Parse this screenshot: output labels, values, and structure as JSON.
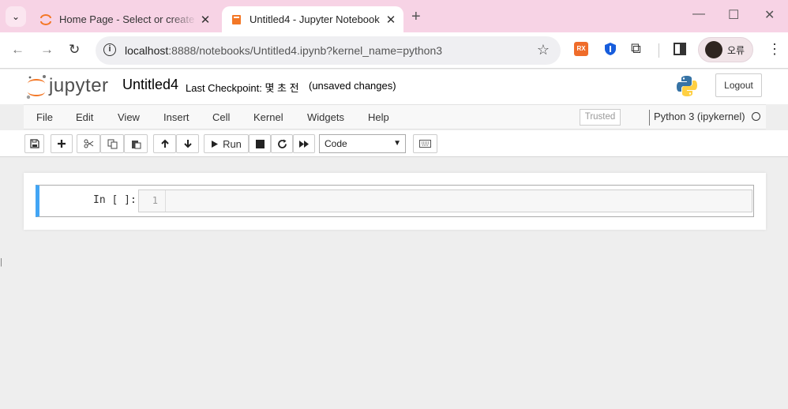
{
  "browser": {
    "tabs": [
      {
        "title": "Home Page - Select or create",
        "close": "✕"
      },
      {
        "title": "Untitled4 - Jupyter Notebook",
        "close": "✕"
      }
    ],
    "new_tab": "+",
    "tab_search_icon": "⌄",
    "window_controls": {
      "minimize": "—",
      "maximize": "☐",
      "close": "✕"
    },
    "nav": {
      "back": "←",
      "forward": "→",
      "reload": "↻"
    },
    "url_host": "localhost",
    "url_rest": ":8888/notebooks/Untitled4.ipynb?kernel_name=python3",
    "bookmark_icon": "☆",
    "extension_rx": "RX",
    "puzzle_icon": "⧉",
    "profile_label": "오류",
    "menu_icon": "⋮",
    "accent": "#f7d3e5"
  },
  "header": {
    "logo_text": "jupyter",
    "notebook_title": "Untitled4",
    "checkpoint_label": "Last Checkpoint:",
    "checkpoint_time": "몇 초 전",
    "unsaved": "(unsaved changes)",
    "logout": "Logout"
  },
  "menubar": {
    "items": [
      "File",
      "Edit",
      "View",
      "Insert",
      "Cell",
      "Kernel",
      "Widgets",
      "Help"
    ],
    "trusted": "Trusted",
    "kernel_name": "Python 3 (ipykernel)"
  },
  "toolbar": {
    "run_label": "Run",
    "cell_type": "Code",
    "cell_type_options": [
      "Code"
    ]
  },
  "cell": {
    "prompt": "In [ ]:",
    "line_number": "1",
    "source": "",
    "accent": "#42a5f5"
  },
  "edge_mark": "|"
}
